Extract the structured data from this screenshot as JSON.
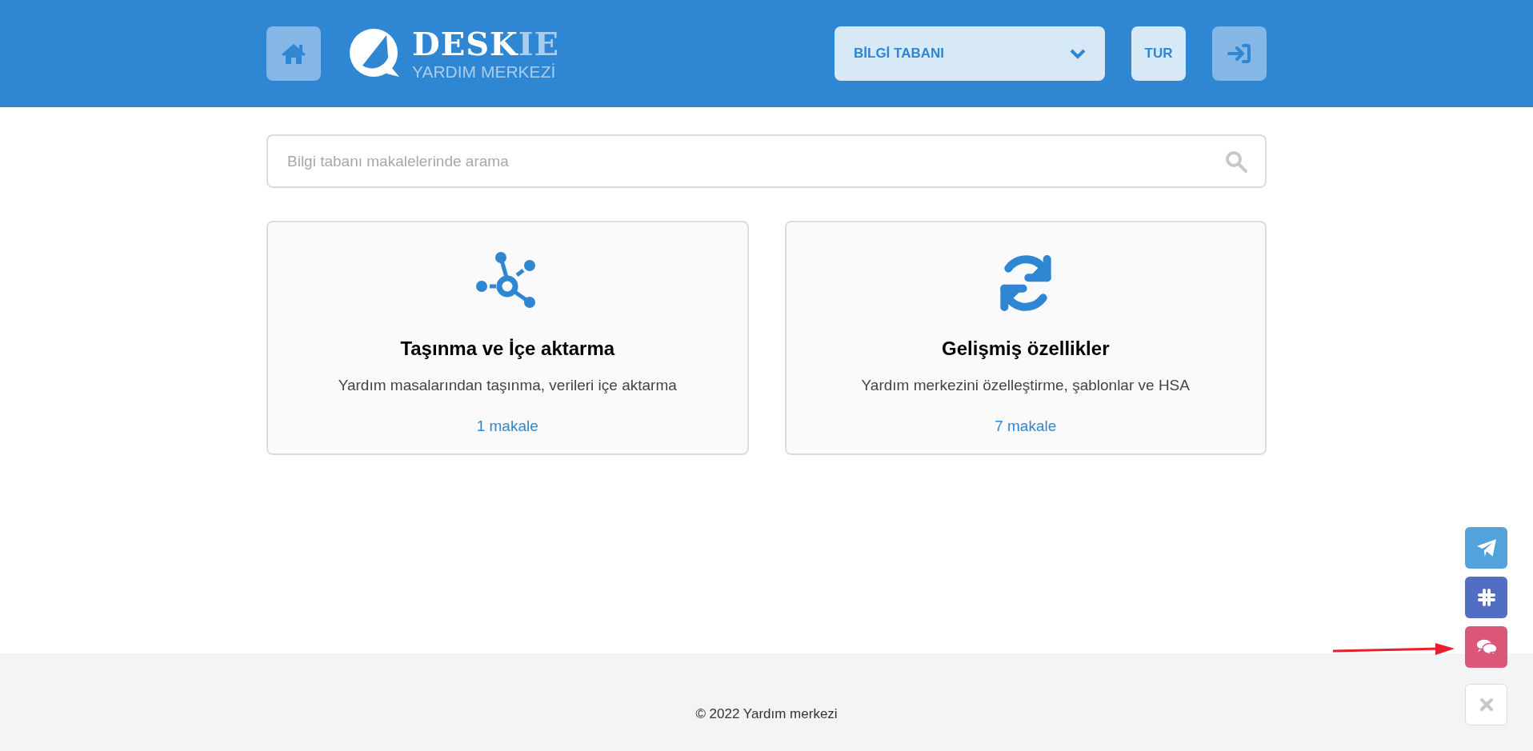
{
  "header": {
    "logo": {
      "word_main": "DESK",
      "word_accent": "IE",
      "subtitle": "YARDIM MERKEZİ"
    },
    "section_dropdown": {
      "label": "BİLGİ TABANI",
      "expanded": false
    },
    "language": "TUR"
  },
  "search": {
    "placeholder": "Bilgi tabanı makalelerinde arama"
  },
  "categories": [
    {
      "kind": "network",
      "title": "Taşınma ve İçe aktarma",
      "description": "Yardım masalarından taşınma, verileri içe aktarma",
      "count": "1 makale"
    },
    {
      "kind": "sync",
      "title": "Gelişmiş özellikler",
      "description": "Yardım merkezini özelleştirme, şablonlar ve HSA",
      "count": "7 makale"
    }
  ],
  "footer": {
    "copyright": "© 2022 Yardım merkezi"
  },
  "widget_buttons": [
    {
      "kind": "telegram",
      "color": "#52a3db"
    },
    {
      "kind": "slack",
      "color": "#526ec2"
    },
    {
      "kind": "chat",
      "color": "#db577a"
    },
    {
      "kind": "close",
      "color": "#ffffff"
    }
  ]
}
